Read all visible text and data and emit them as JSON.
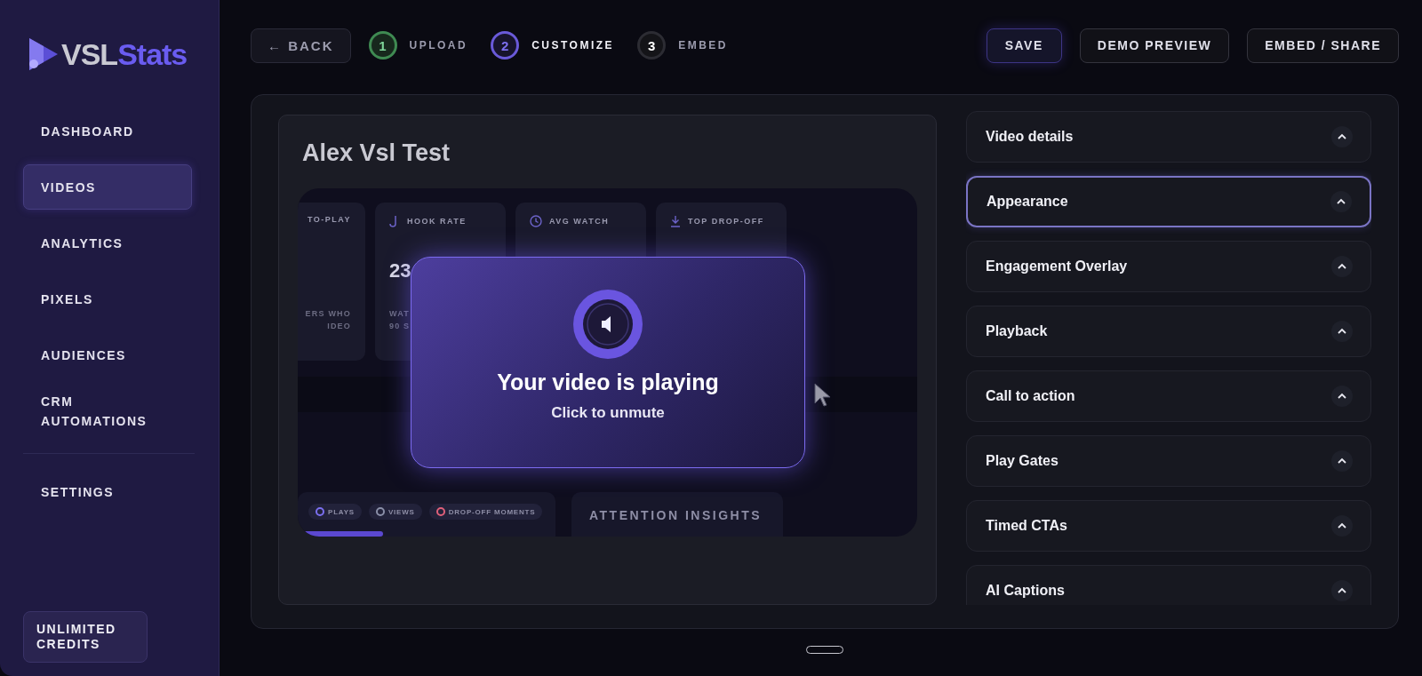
{
  "logo": {
    "text_a": "VSL",
    "text_b": "Stats"
  },
  "sidebar": {
    "items": [
      {
        "label": "DASHBOARD",
        "selected": false
      },
      {
        "label": "VIDEOS",
        "selected": true
      },
      {
        "label": "ANALYTICS",
        "selected": false
      },
      {
        "label": "PIXELS",
        "selected": false
      },
      {
        "label": "AUDIENCES",
        "selected": false
      },
      {
        "label": "CRM AUTOMATIONS",
        "selected": false
      }
    ],
    "footer_items": [
      {
        "label": "SETTINGS",
        "selected": false
      }
    ],
    "credits": "UNLIMITED CREDITS"
  },
  "top_bar": {
    "back": {
      "icon": "←",
      "label": "BACK"
    },
    "steps": [
      {
        "number": "1",
        "label": "UPLOAD",
        "done": true,
        "selected": false
      },
      {
        "number": "2",
        "label": "CUSTOMIZE",
        "done": false,
        "selected": true
      },
      {
        "number": "3",
        "label": "EMBED",
        "done": false,
        "selected": false
      }
    ],
    "buttons": [
      {
        "label": "SAVE",
        "kind": "primary"
      },
      {
        "label": "DEMO PREVIEW",
        "kind": "secondary"
      },
      {
        "label": "EMBED / SHARE",
        "kind": "secondary"
      }
    ]
  },
  "editor": {
    "title": "Alex Vsl Test",
    "video": {
      "metric_cards": [
        {
          "label": "TO-PLAY",
          "caption": "ERS WHO\nIDEO"
        },
        {
          "label": "HOOK RATE",
          "value": "23",
          "caption": "WAT\n90 S"
        },
        {
          "label": "AVG WATCH"
        },
        {
          "label": "TOP DROP-OFF"
        }
      ],
      "progress": {
        "level": 0.33
      },
      "legend": [
        {
          "label": "PLAYS",
          "color": "#7b6ff0"
        },
        {
          "label": "VIEWS",
          "color": "#8a8fa8"
        },
        {
          "label": "DROP-OFF MOMENTS",
          "color": "#e0607a"
        }
      ],
      "insights_title": "ATTENTION INSIGHTS",
      "overlay": {
        "title": "Your video is playing",
        "subtitle": "Click to unmute"
      }
    }
  },
  "settings_sections": [
    {
      "title": "Video details",
      "selected": false
    },
    {
      "title": "Appearance",
      "selected": true
    },
    {
      "title": "Engagement Overlay",
      "selected": false
    },
    {
      "title": "Playback",
      "selected": false
    },
    {
      "title": "Call to action",
      "selected": false
    },
    {
      "title": "Play Gates",
      "selected": false
    },
    {
      "title": "Timed CTAs",
      "selected": false
    },
    {
      "title": "AI Captions",
      "selected": false
    }
  ]
}
